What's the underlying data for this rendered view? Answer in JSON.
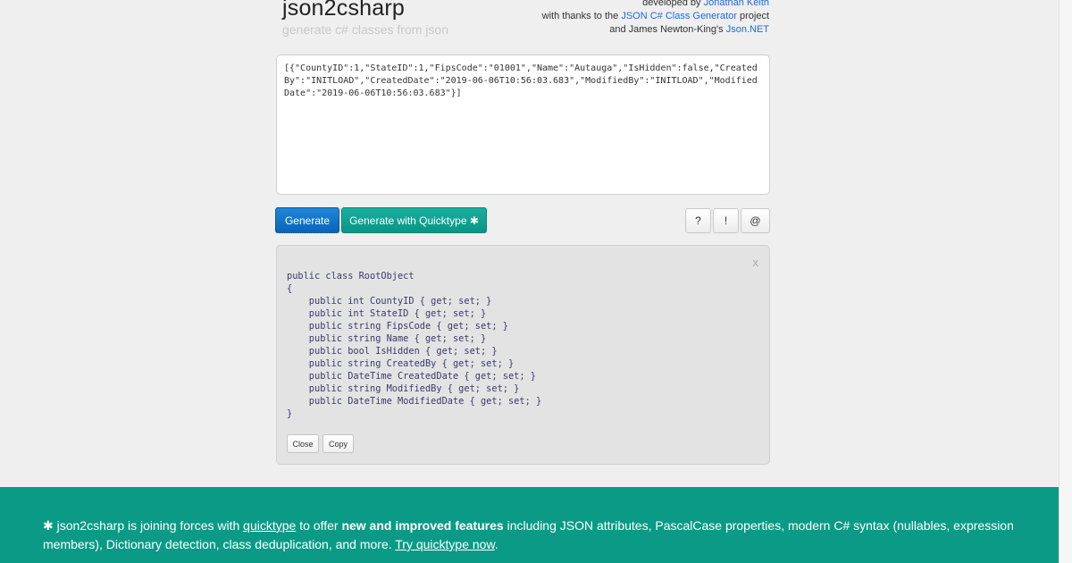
{
  "header": {
    "title": "json2csharp",
    "subtitle": "generate c# classes from json",
    "credits": {
      "line1_prefix": "developed by ",
      "line1_link": "Jonathan Keith",
      "line2_prefix": "with thanks to the ",
      "line2_link": "JSON C# Class Generator",
      "line2_suffix": " project",
      "line3_prefix": "and James Newton-King's ",
      "line3_link": "Json.NET"
    }
  },
  "input": {
    "value": "[{\"CountyID\":1,\"StateID\":1,\"FipsCode\":\"01001\",\"Name\":\"Autauga\",\"IsHidden\":false,\"CreatedBy\":\"INITLOAD\",\"CreatedDate\":\"2019-06-06T10:56:03.683\",\"ModifiedBy\":\"INITLOAD\",\"ModifiedDate\":\"2019-06-06T10:56:03.683\"}]"
  },
  "toolbar": {
    "generate_label": "Generate",
    "quicktype_label": "Generate with Quicktype ✱",
    "help_label": "?",
    "about_label": "!",
    "contact_label": "@"
  },
  "output": {
    "close_x": "x",
    "code": "public class RootObject\n{\n    public int CountyID { get; set; }\n    public int StateID { get; set; }\n    public string FipsCode { get; set; }\n    public string Name { get; set; }\n    public bool IsHidden { get; set; }\n    public string CreatedBy { get; set; }\n    public DateTime CreatedDate { get; set; }\n    public string ModifiedBy { get; set; }\n    public DateTime ModifiedDate { get; set; }\n}",
    "close_label": "Close",
    "copy_label": "Copy"
  },
  "banner": {
    "prefix": "✱ json2csharp is joining forces with ",
    "link1": "quicktype",
    "mid1": " to offer ",
    "bold": "new and improved features",
    "mid2": " including JSON attributes, PascalCase properties, modern C# syntax (nullables, expression members), Dictionary detection, class deduplication, and more. ",
    "link2": "Try quicktype now",
    "suffix": "."
  },
  "colors": {
    "generate_button": "#0a64b8",
    "quicktype_button": "#0b9585",
    "banner": "#0b9a86",
    "link": "#1d6cd6"
  }
}
